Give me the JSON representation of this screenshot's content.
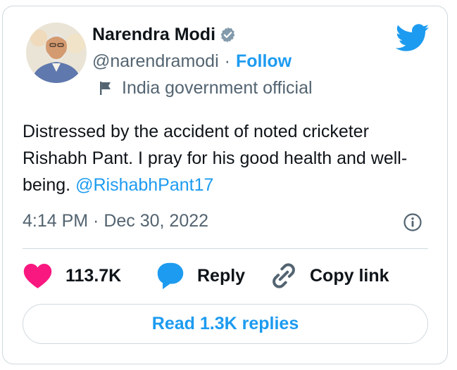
{
  "author": {
    "name": "Narendra Modi",
    "handle": "@narendramodi",
    "separator": "·",
    "follow_label": "Follow",
    "account_label": "India government official"
  },
  "tweet": {
    "text": "Distressed by the accident of noted cricketer Rishabh Pant. I pray for his good health and well-being.",
    "mention": "@RishabhPant17",
    "timestamp": "4:14 PM · Dec 30, 2022"
  },
  "actions": {
    "like_count": "113.7K",
    "reply_label": "Reply",
    "copy_link_label": "Copy link"
  },
  "read_replies_label": "Read 1.3K replies",
  "icons": {
    "verified": "verified-badge-icon",
    "flag": "flag-icon",
    "brand": "twitter-bird-icon",
    "info": "info-icon",
    "like": "heart-icon",
    "reply": "speech-bubble-icon",
    "copy": "link-icon"
  },
  "colors": {
    "accent": "#1d9bf0",
    "like": "#f91880",
    "text": "#0f1419",
    "secondary": "#536471",
    "border": "#cfd9de"
  }
}
